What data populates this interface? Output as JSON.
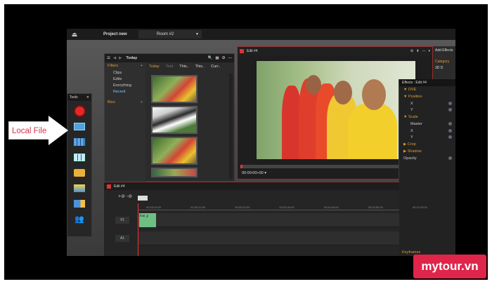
{
  "topbar": {
    "project": "Project new",
    "room": "Room #2"
  },
  "callout": {
    "label": "Local File"
  },
  "tools": {
    "title": "Tools"
  },
  "library": {
    "title": "Today",
    "filters_label": "Filters",
    "filters": [
      "Clips",
      "Edits",
      "Everything",
      "Recent"
    ],
    "bins_label": "Bins",
    "tabs": [
      "Today",
      "Yest",
      "This..",
      "This..",
      "Curr.."
    ]
  },
  "viewer": {
    "title": "Edit #4",
    "timecode": "00:00:00+00 ▾"
  },
  "effects": {
    "header": "Effects : Edit #4",
    "sections": [
      {
        "name": "DVE",
        "rows": []
      },
      {
        "name": "Position",
        "rows": [
          "X",
          "Y"
        ]
      },
      {
        "name": "Scale",
        "rows": [
          "Master",
          "X",
          "Y"
        ]
      },
      {
        "name": "Crop",
        "rows": []
      },
      {
        "name": "Shadow",
        "rows": []
      }
    ],
    "opacity_label": "Opacity",
    "keyframes_label": "Keyframes"
  },
  "add_effects": {
    "title": "Add Effects",
    "category": "Category",
    "item": "3D D"
  },
  "timeline": {
    "title": "Edit #4",
    "tracks": [
      "V1",
      "A1"
    ],
    "clip_label": "four_ji",
    "ruler": [
      "00:00:00:00",
      "00:00:10:00",
      "00:00:20:00",
      "00:00:30:00",
      "00:00:40:00",
      "00:00:50:00",
      "00:01:00:00"
    ]
  },
  "brand": {
    "name": "mytour.vn"
  }
}
